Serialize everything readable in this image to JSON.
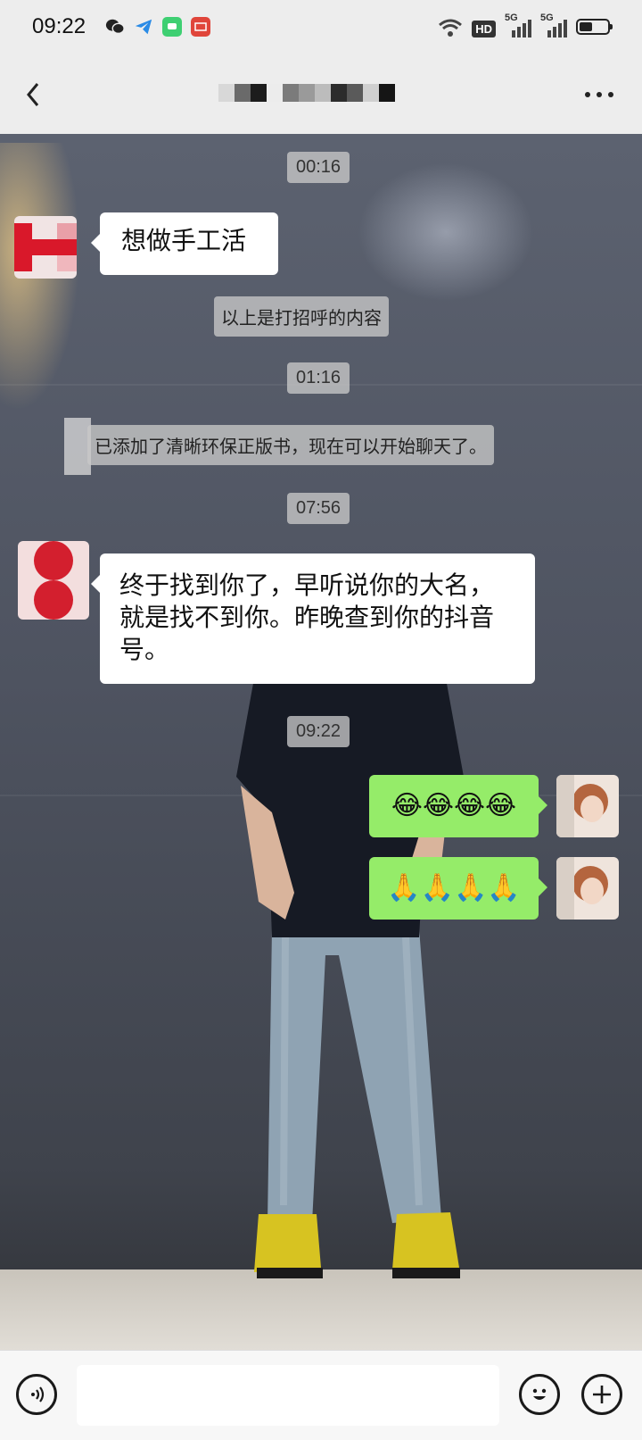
{
  "status_bar": {
    "time": "09:22",
    "network_left": "5G",
    "network_right": "5G",
    "hd_label": "HD",
    "battery_level": 0.45,
    "notification_icons": [
      "wechat-icon",
      "telegram-icon",
      "message-icon",
      "news-icon"
    ]
  },
  "nav": {
    "title_redacted": true
  },
  "chat": {
    "items": [
      {
        "type": "time",
        "text": "00:16"
      },
      {
        "type": "incoming",
        "text": "想做手工活"
      },
      {
        "type": "system",
        "text": "以上是打招呼的内容"
      },
      {
        "type": "time",
        "text": "01:16"
      },
      {
        "type": "system",
        "text": "已添加了清晰环保正版书，现在可以开始聊天了。"
      },
      {
        "type": "time",
        "text": "07:56"
      },
      {
        "type": "incoming",
        "text": "终于找到你了，早听说你的大名，就是找不到你。昨晚查到你的抖音号。"
      },
      {
        "type": "time",
        "text": "09:22"
      },
      {
        "type": "outgoing",
        "text": "😂😂😂😂"
      },
      {
        "type": "outgoing",
        "text": "🙏🙏🙏🙏"
      }
    ]
  },
  "input_bar": {
    "placeholder": "",
    "voice_icon": "voice-icon",
    "emoji_icon": "emoji-icon",
    "plus_icon": "plus-icon"
  },
  "colors": {
    "outgoing_bubble": "#95ec69",
    "incoming_bubble": "#ffffff",
    "bar_background": "#ededed"
  }
}
